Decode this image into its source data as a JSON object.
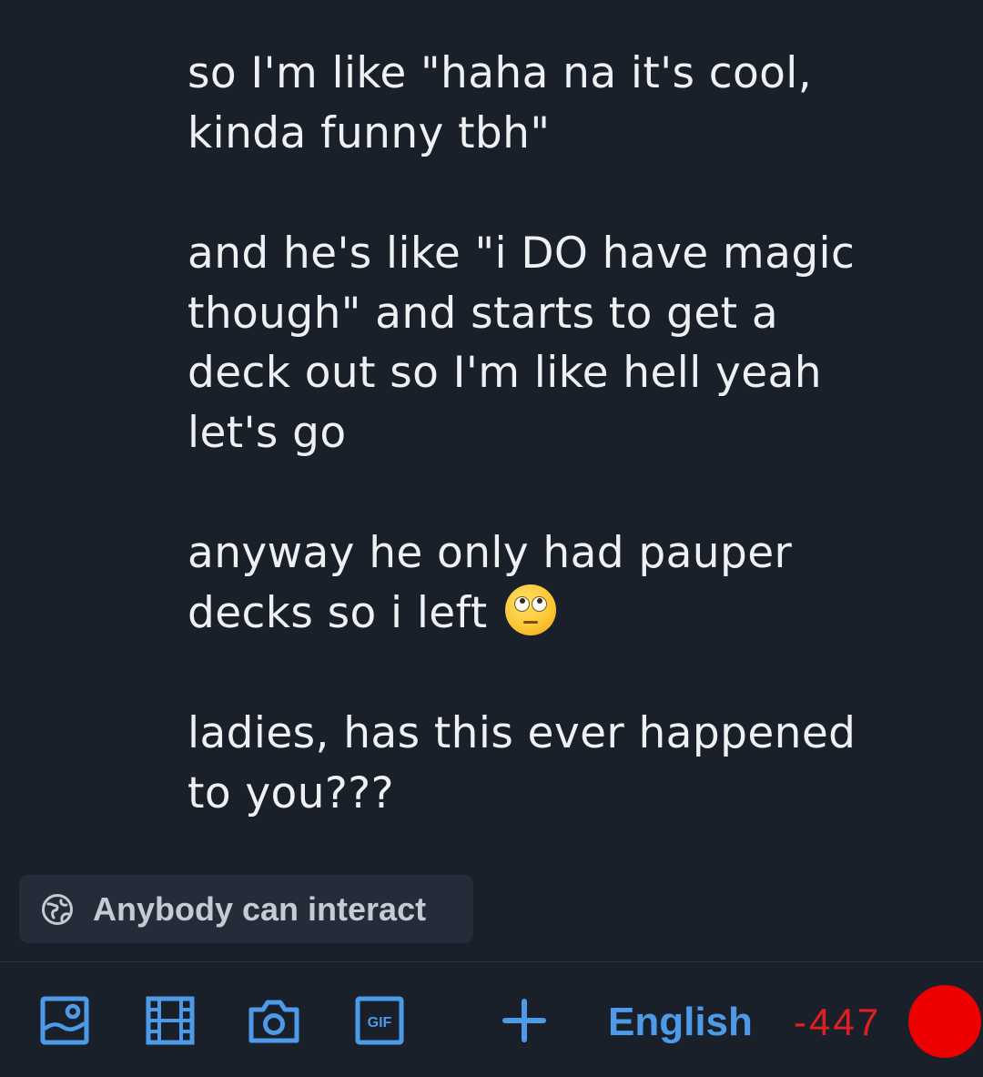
{
  "post": {
    "paragraphs": [
      "so I'm like \"haha na it's cool,\nkinda funny tbh\"",
      "and he's like \"i DO have magic\nthough\" and starts to get a\ndeck out so I'm like hell yeah\nlet's go",
      "anyway he only had pauper\ndecks so i left",
      "ladies, has this ever happened\nto you???"
    ],
    "emoji": "face-with-rolling-eyes"
  },
  "audience": {
    "label": "Anybody can interact",
    "icon": "globe-icon"
  },
  "toolbar": {
    "buttons": [
      {
        "name": "image-icon"
      },
      {
        "name": "video-icon"
      },
      {
        "name": "camera-icon"
      },
      {
        "name": "gif-icon",
        "label": "GIF"
      },
      {
        "name": "plus-icon"
      }
    ],
    "language": "English",
    "char_remaining": "-447"
  },
  "colors": {
    "background": "#1a202a",
    "accent": "#4c9ae8",
    "over_limit": "#e02020",
    "text": "#eef0f4",
    "chip_bg": "#232c38"
  }
}
